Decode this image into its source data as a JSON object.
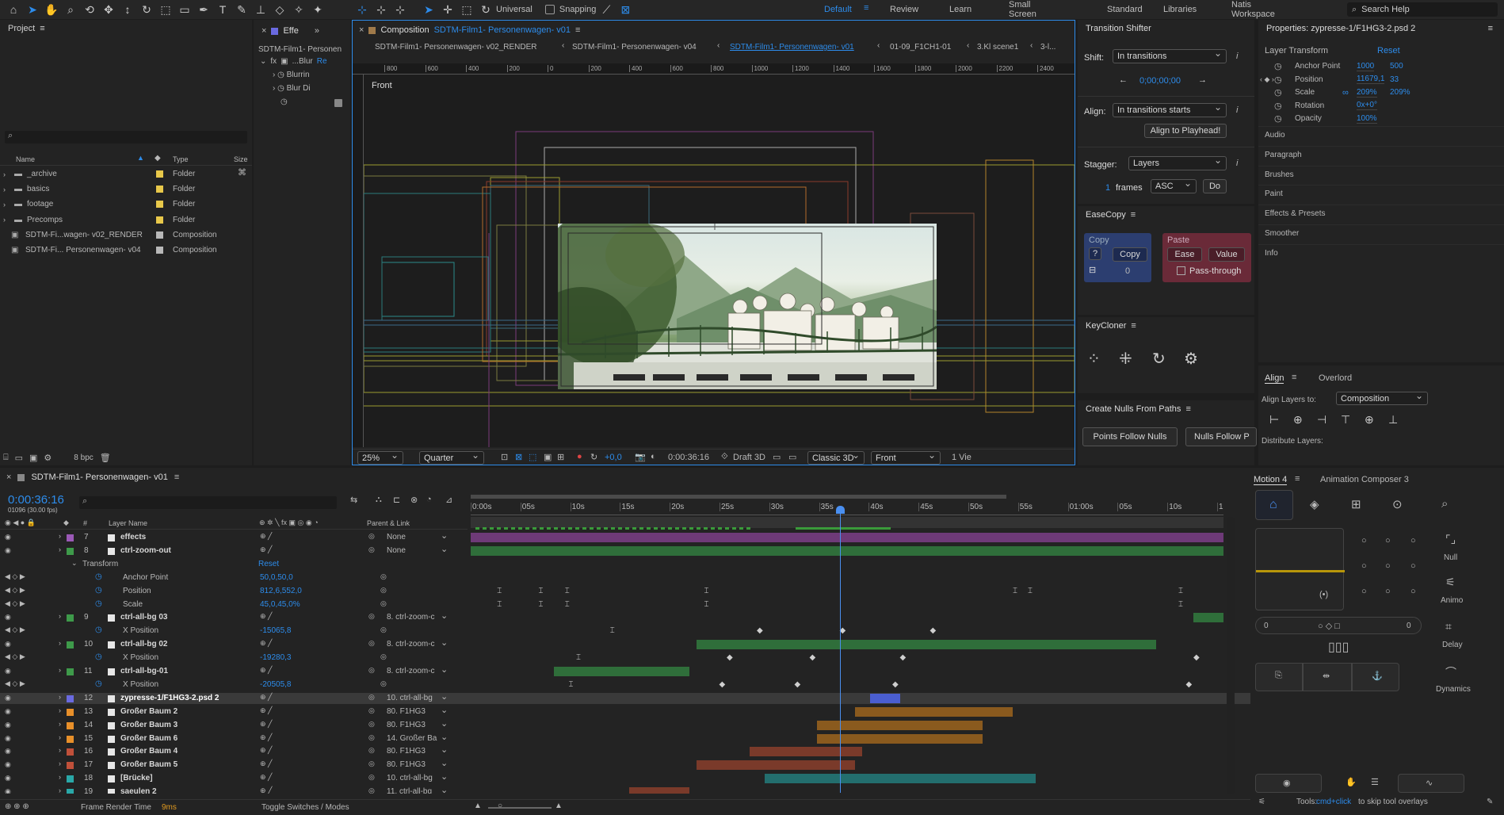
{
  "toolbar": {
    "universal_label": "Universal",
    "snapping_label": "Snapping",
    "workspaces": [
      "Default",
      "Review",
      "Learn",
      "Small Screen",
      "Standard",
      "Libraries",
      "Natis Workspace"
    ],
    "search_placeholder": "Search Help"
  },
  "project": {
    "title": "Project",
    "col_name": "Name",
    "col_type": "Type",
    "col_size": "Size",
    "items": [
      {
        "name": "_archive",
        "type": "Folder",
        "color": "#e8c84a"
      },
      {
        "name": "basics",
        "type": "Folder",
        "color": "#e8c84a"
      },
      {
        "name": "footage",
        "type": "Folder",
        "color": "#e8c84a"
      },
      {
        "name": "Precomps",
        "type": "Folder",
        "color": "#e8c84a"
      },
      {
        "name": "SDTM-Fi...wagen- v02_RENDER",
        "type": "Composition",
        "color": "#b8b8b8"
      },
      {
        "name": "SDTM-Fi... Personenwagen- v04",
        "type": "Composition",
        "color": "#b8b8b8"
      }
    ],
    "bpc": "8 bpc"
  },
  "effects": {
    "tab": "Effe",
    "comp": "SDTM-Film1- Personen",
    "fx_name": "...Blur",
    "fx_reset": "Re",
    "params": [
      "Blurrin",
      "Blur Di"
    ]
  },
  "comp": {
    "tab_prefix": "Composition",
    "tab_name": "SDTM-Film1- Personenwagen- v01",
    "subtabs": [
      "SDTM-Film1- Personenwagen- v02_RENDER",
      "SDTM-Film1- Personenwagen- v04",
      "SDTM-Film1- Personenwagen- v01",
      "01-09_F1CH1-01",
      "3.Kl scene1",
      "3-l..."
    ],
    "view_label": "Front",
    "ruler": [
      "800",
      "600",
      "400",
      "200",
      "0",
      "200",
      "400",
      "600",
      "800",
      "1000",
      "1200",
      "1400",
      "1600",
      "1800",
      "2000",
      "2200",
      "2400",
      "26"
    ],
    "zoom": "25%",
    "resolution": "Quarter",
    "exposure": "+0,0",
    "timecode": "0:00:36:16",
    "renderer_label": "Draft 3D",
    "renderer": "Classic 3D",
    "camera": "Front",
    "views": "1 Vie"
  },
  "transition_shifter": {
    "title": "Transition Shifter",
    "shift_label": "Shift:",
    "shift_value": "In transitions",
    "time": "0;00;00;00",
    "align_label": "Align:",
    "align_value": "In transitions starts",
    "align_button": "Align to Playhead!",
    "stagger_label": "Stagger:",
    "stagger_value": "Layers",
    "frames_value": "1",
    "frames_label": "frames",
    "order": "ASC",
    "do_button": "Do"
  },
  "easecopy": {
    "title": "EaseCopy",
    "copy_label": "Copy",
    "copy_button": "Copy",
    "q_button": "?",
    "count": "0",
    "paste_label": "Paste",
    "ease_button": "Ease",
    "value_button": "Value",
    "passthrough": "Pass-through"
  },
  "keycloner": {
    "title": "KeyCloner"
  },
  "nulls": {
    "title": "Create Nulls From Paths",
    "btn1": "Points Follow Nulls",
    "btn2": "Nulls Follow P"
  },
  "properties": {
    "title": "Properties: zypresse-1/F1HG3-2.psd 2",
    "section": "Layer Transform",
    "reset": "Reset",
    "rows": [
      {
        "label": "Anchor Point",
        "v1": "1000",
        "v2": "500"
      },
      {
        "label": "Position",
        "v1": "11679,1",
        "v2": "33"
      },
      {
        "label": "Scale",
        "v1": "209%",
        "v2": "209%"
      },
      {
        "label": "Rotation",
        "v1": "0x+0°",
        "v2": ""
      },
      {
        "label": "Opacity",
        "v1": "100%",
        "v2": ""
      }
    ],
    "panels": [
      "Audio",
      "Paragraph",
      "Brushes",
      "Paint",
      "Effects & Presets",
      "Smoother",
      "Info"
    ]
  },
  "align": {
    "tab1": "Align",
    "tab2": "Overlord",
    "align_to_label": "Align Layers to:",
    "align_to_value": "Composition",
    "distribute_label": "Distribute Layers:"
  },
  "timeline": {
    "comp_name": "SDTM-Film1- Personenwagen- v01",
    "timecode": "0:00:36:16",
    "frames": "01096 (30.00 fps)",
    "col_layer": "Layer Name",
    "col_parent": "Parent & Link",
    "ruler": [
      "0:00s",
      "05s",
      "10s",
      "15s",
      "20s",
      "25s",
      "30s",
      "35s",
      "40s",
      "45s",
      "50s",
      "55s",
      "01:00s",
      "05s",
      "10s",
      "1"
    ],
    "layers": [
      {
        "num": "7",
        "name": "effects",
        "label": "#9b59b6",
        "parent": "None",
        "bar_color": "#6e3a78",
        "bar_start": 0,
        "bar_end": 100
      },
      {
        "num": "8",
        "name": "ctrl-zoom-out",
        "label": "#3e9a4a",
        "parent": "None",
        "bar_color": "#2f6e3a",
        "bar_start": 0,
        "bar_end": 100
      },
      {
        "prop": "Transform",
        "reset": "Reset"
      },
      {
        "prop": "Anchor Point",
        "value": "50,0,50,0"
      },
      {
        "prop": "Position",
        "value": "812,6,552,0"
      },
      {
        "prop": "Scale",
        "value": "45,0,45,0%"
      },
      {
        "num": "9",
        "name": "ctrl-all-bg 03",
        "label": "#3e9a4a",
        "parent": "8. ctrl-zoom-c",
        "bar_color": "#2f6e3a",
        "bar_start": 96,
        "bar_end": 100
      },
      {
        "prop": "X Position",
        "value": "-15065,8"
      },
      {
        "num": "10",
        "name": "ctrl-all-bg 02",
        "label": "#3e9a4a",
        "parent": "8. ctrl-zoom-c",
        "bar_color": "#2f6e3a",
        "bar_start": 30,
        "bar_end": 91
      },
      {
        "prop": "X Position",
        "value": "-19280,3"
      },
      {
        "num": "11",
        "name": "ctrl-all-bg-01",
        "label": "#3e9a4a",
        "parent": "8. ctrl-zoom-c",
        "bar_color": "#2f6e3a",
        "bar_start": 11,
        "bar_end": 29
      },
      {
        "prop": "X Position",
        "value": "-20505,8"
      },
      {
        "num": "12",
        "name": "zypresse-1/F1HG3-2.psd 2",
        "label": "#6a6ae0",
        "parent": "10. ctrl-all-bg",
        "bar_color": "#4a5ed0",
        "bar_start": 53,
        "bar_end": 57
      },
      {
        "num": "13",
        "name": "Großer Baum 2",
        "label": "#e8902a",
        "parent": "80. F1HG3",
        "bar_color": "#8a5a1e",
        "bar_start": 51,
        "bar_end": 72
      },
      {
        "num": "14",
        "name": "Großer Baum 3",
        "label": "#e8902a",
        "parent": "80. F1HG3",
        "bar_color": "#8a5a1e",
        "bar_start": 46,
        "bar_end": 68
      },
      {
        "num": "15",
        "name": "Großer Baum 6",
        "label": "#e8902a",
        "parent": "14. Großer Ba",
        "bar_color": "#8a5a1e",
        "bar_start": 46,
        "bar_end": 68
      },
      {
        "num": "16",
        "name": "Großer Baum 4",
        "label": "#c0503a",
        "parent": "80. F1HG3",
        "bar_color": "#7a3a2a",
        "bar_start": 37,
        "bar_end": 52
      },
      {
        "num": "17",
        "name": "Großer Baum 5",
        "label": "#c0503a",
        "parent": "80. F1HG3",
        "bar_color": "#7a3a2a",
        "bar_start": 30,
        "bar_end": 51
      },
      {
        "num": "18",
        "name": "[Brücke]",
        "label": "#2aa8a8",
        "parent": "10. ctrl-all-bg",
        "bar_color": "#236e6e",
        "bar_start": 39,
        "bar_end": 75
      },
      {
        "num": "19",
        "name": "saeulen 2",
        "label": "#2aa8a8",
        "parent": "11. ctrl-all-bg",
        "bar_color": "#7a3a2a",
        "bar_start": 21,
        "bar_end": 29
      }
    ],
    "footer_render": "Frame Render Time",
    "footer_ms": "9ms",
    "footer_toggle": "Toggle Switches / Modes"
  },
  "motion": {
    "tab1": "Motion 4",
    "tab2": "Animation Composer 3",
    "null_label": "Null",
    "animo_label": "Animo",
    "delay_label": "Delay",
    "dynamics_label": "Dynamics",
    "left_val": "0",
    "right_val": "0",
    "tools_hint_a": "Tools:",
    "tools_hint_b": "cmd+click",
    "tools_hint_c": "to skip tool overlays"
  }
}
